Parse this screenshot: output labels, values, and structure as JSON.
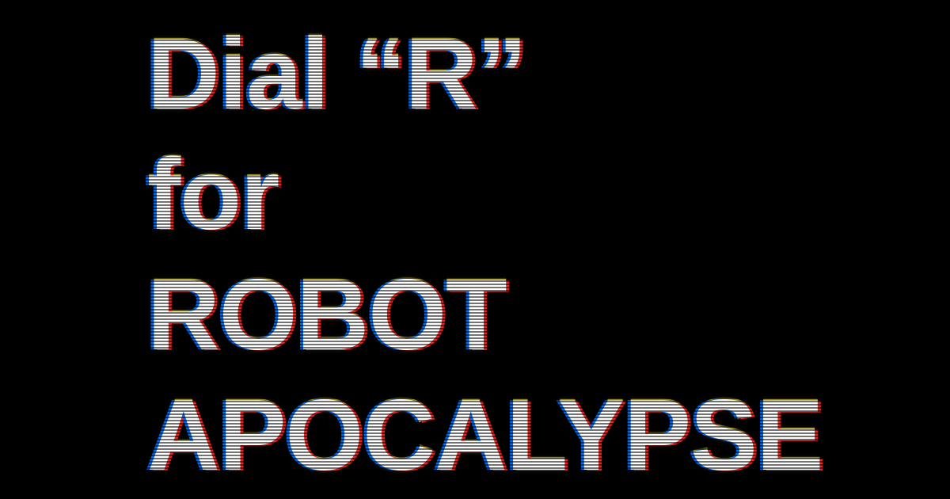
{
  "title": {
    "lines": [
      "Dial “R”",
      "for",
      "ROBOT",
      "APOCALYPSE"
    ]
  },
  "colors": {
    "background": "#000000",
    "text": "#ffffff",
    "fringe_blue": "#006eff",
    "fringe_red": "#ff281e",
    "fringe_yellow": "#ffe628"
  }
}
